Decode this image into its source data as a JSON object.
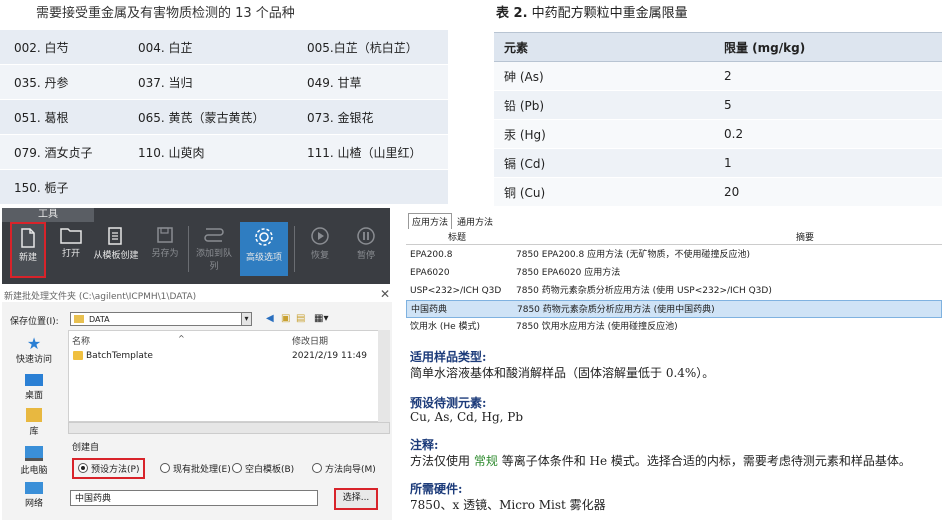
{
  "herb_panel": {
    "title": "需要接受重金属及有害物质检测的 13 个品种",
    "rows": [
      [
        "002. 白芍",
        "004. 白芷",
        "005.白芷（杭白芷）"
      ],
      [
        "035. 丹参",
        "037. 当归",
        "049. 甘草"
      ],
      [
        "051. 葛根",
        "065. 黄芪（蒙古黄芪）",
        "073. 金银花"
      ],
      [
        "079. 酒女贞子",
        "110. 山萸肉",
        "111. 山楂（山里红）"
      ],
      [
        "150. 栀子",
        "",
        ""
      ]
    ]
  },
  "metal_panel": {
    "title_bold": "表 2.",
    "title_rest": " 中药配方颗粒中重金属限量",
    "headers": [
      "元素",
      "限量 (mg/kg)"
    ],
    "rows": [
      [
        "砷 (As)",
        "2"
      ],
      [
        "铅 (Pb)",
        "5"
      ],
      [
        "汞 (Hg)",
        "0.2"
      ],
      [
        "镉 (Cd)",
        "1"
      ],
      [
        "铜 (Cu)",
        "20"
      ]
    ]
  },
  "toolbar": {
    "tab_label": "工具",
    "buttons": {
      "new": "新建",
      "open": "打开",
      "from_template": "从模板创建",
      "save_as": "另存为",
      "add_to_queue": "添加到队列",
      "advanced": "高级选项",
      "restore": "恢复",
      "pause": "暂停"
    }
  },
  "dialog": {
    "title": "新建批处理文件夹 (C:\\agilent\\ICPMH\\1\\DATA)",
    "save_location_label": "保存位置(I):",
    "save_location_value": "DATA",
    "sidebar": [
      "快速访问",
      "桌面",
      "库",
      "此电脑",
      "网络"
    ],
    "columns": [
      "名称",
      "修改日期"
    ],
    "files": [
      {
        "name": "BatchTemplate",
        "date": "2021/2/19 11:49"
      }
    ],
    "create_from_label": "创建自",
    "radios": [
      "预设方法(P)",
      "现有批处理(E)",
      "空白模板(B)",
      "方法向导(M)"
    ],
    "selected_radio": 0,
    "method_value": "中国药典",
    "select_button": "选择..."
  },
  "method_panel": {
    "tabs": [
      "应用方法",
      "通用方法"
    ],
    "headers": [
      "标题",
      "摘要"
    ],
    "rows": [
      [
        "EPA200.8",
        "7850 EPA200.8 应用方法 (无矿物质，不使用碰撞反应池)"
      ],
      [
        "EPA6020",
        "7850 EPA6020 应用方法"
      ],
      [
        "USP<232>/ICH Q3D",
        "7850 药物元素杂质分析应用方法 (使用 USP<232>/ICH Q3D)"
      ],
      [
        "中国药典",
        "7850 药物元素杂质分析应用方法 (使用中国药典)"
      ],
      [
        "饮用水 (He 模式)",
        "7850 饮用水应用方法 (使用碰撞反应池)"
      ]
    ],
    "selected_row": 3,
    "sample_type_heading": "适用样品类型:",
    "sample_type_text": "简单水溶液基体和酸消解样品（固体溶解量低于 0.4%）。",
    "elements_heading": "预设待测元素:",
    "elements_text": "Cu, As, Cd, Hg, Pb",
    "note_heading": "注释:",
    "note_text_1": "方法仅使用",
    "note_text_green": "常规",
    "note_text_2": "等离子体条件和 He 模式。选择合适的内标，需要考虑待测元素和样品基体。",
    "hardware_heading": "所需硬件:",
    "hardware_text": "7850、x 透镜、Micro Mist 雾化器"
  },
  "colors": {
    "toolbar_bg": "#3a3d42",
    "advanced_btn": "#2f7dc1",
    "highlight_red": "#d8232a",
    "heading_blue": "#1c3b7a",
    "selected_row": "#cfe3f6"
  }
}
